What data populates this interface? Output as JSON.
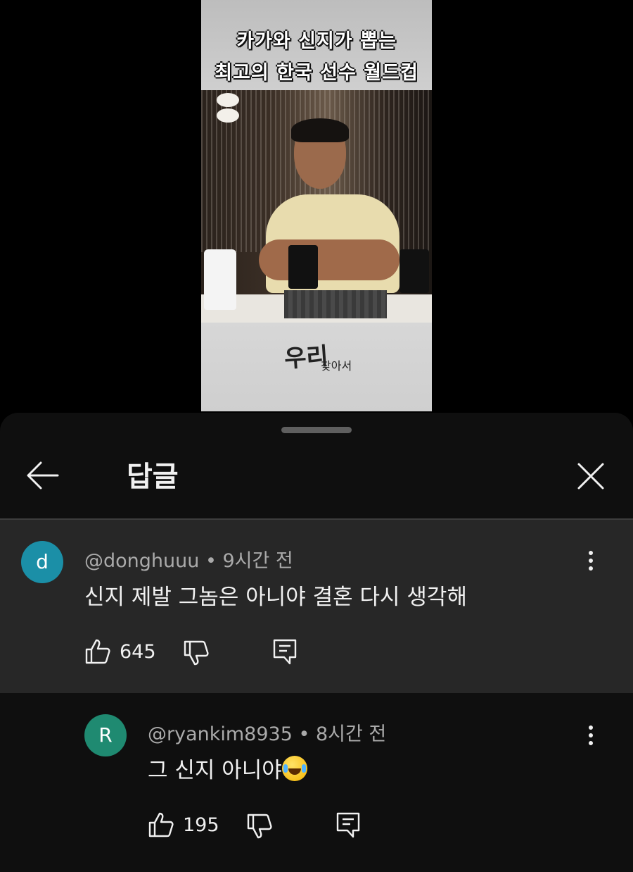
{
  "video": {
    "title_line1": "카가와 신지가 뽑는",
    "title_line2": "최고의 한국 선수 월드컵",
    "show_logo": "우리",
    "show_logo_sub": "찾아서"
  },
  "panel": {
    "title": "답글"
  },
  "comments": [
    {
      "avatar_letter": "d",
      "avatar_color": "#1b8fa7",
      "meta": "@donghuuu • 9시간 전",
      "text": "신지 제발 그놈은 아니야 결혼 다시 생각해",
      "likes": "645"
    },
    {
      "avatar_letter": "R",
      "avatar_color": "#1f8a71",
      "meta": "@ryankim8935 • 8시간 전",
      "text": "그 신지 아니야",
      "likes": "195"
    }
  ],
  "icons": {
    "back": "arrow-left-icon",
    "close": "close-icon",
    "more": "more-vert-icon",
    "like": "thumbs-up-icon",
    "dislike": "thumbs-down-icon",
    "reply": "reply-icon",
    "emoji": "laughing-tears-emoji"
  }
}
